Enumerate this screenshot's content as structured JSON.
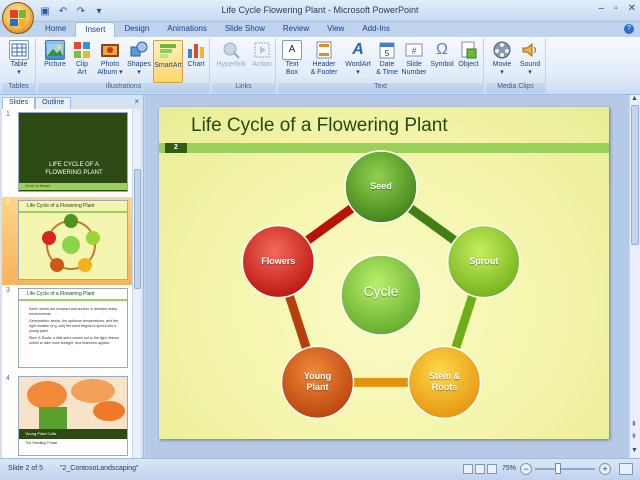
{
  "window": {
    "title": "Life Cycle Flowering Plant - Microsoft PowerPoint",
    "controls": {
      "minimize": "–",
      "maximize": "▫",
      "close": "✕"
    }
  },
  "qat": {
    "save_icon": "▣",
    "undo_icon": "↶",
    "redo_icon": "↷",
    "customize_icon": "▾"
  },
  "tabs": [
    {
      "label": "Home",
      "active": false
    },
    {
      "label": "Insert",
      "active": true
    },
    {
      "label": "Design",
      "active": false
    },
    {
      "label": "Animations",
      "active": false
    },
    {
      "label": "Slide Show",
      "active": false
    },
    {
      "label": "Review",
      "active": false
    },
    {
      "label": "View",
      "active": false
    },
    {
      "label": "Add-Ins",
      "active": false
    }
  ],
  "help": "?",
  "ribbon": {
    "groups": {
      "tables": "Tables",
      "illustrations": "Illustrations",
      "links": "Links",
      "text": "Text",
      "media": "Media Clips"
    },
    "buttons": {
      "table": "Table",
      "picture": "Picture",
      "clip_art": "Clip Art",
      "photo_album": "Photo Album",
      "shapes": "Shapes",
      "smartart": "SmartArt",
      "chart": "Chart",
      "hyperlink": "Hyperlink",
      "action": "Action",
      "text_box": "Text Box",
      "header_footer": "Header & Footer",
      "wordart": "WordArt",
      "date_time": "Date & Time",
      "slide_number": "Slide Number",
      "symbol": "Symbol",
      "object": "Object",
      "movie": "Movie",
      "sound": "Sound"
    },
    "button_lines": {
      "clip_art": [
        "Clip",
        "Art"
      ],
      "photo_album": [
        "Photo",
        "Album ▾"
      ],
      "text_box": [
        "Text",
        "Box"
      ],
      "header_footer": [
        "Header",
        "& Footer"
      ],
      "date_time": [
        "Date",
        "& Time"
      ],
      "slide_number": [
        "Slide",
        "Number"
      ]
    }
  },
  "pane": {
    "tabs": [
      "Slides",
      "Outline"
    ],
    "close": "×",
    "thumbs": [
      {
        "num": "1",
        "title_lines": [
          "LIFE CYCLE OF A",
          "FLOWERING PLANT"
        ],
        "subtitle": "Seed to flower"
      },
      {
        "num": "2",
        "title": "Life Cycle of a Flowering Plant"
      },
      {
        "num": "3",
        "title": "Life Cycle of a Flowering Plant",
        "bullets": [
          "Seed: seeds are compact and survive in dormant ready environments.",
          "Germination: seeds, the optimum temperatures, and the right location (e.g. soil) the seed begins to sprout into a young plant.",
          "Stem & Roots: a little stem comes out to the light, leaves unfold to take more sunlight, and branches appear."
        ]
      },
      {
        "num": "4",
        "caption": "Young Plant Cells",
        "caption_sub": "The Seedling Phase"
      }
    ]
  },
  "slide": {
    "title": "Life Cycle of a Flowering Plant",
    "number": "2",
    "center": "Cycle",
    "nodes": [
      {
        "label": "Seed",
        "color_light": "#8fd14f",
        "color_dark": "#3f7f16"
      },
      {
        "label": "Sprout",
        "color_light": "#c6ef5f",
        "color_dark": "#6fae18"
      },
      {
        "label": "Stem & Roots",
        "color_light": "#ffd94a",
        "color_dark": "#e3920c"
      },
      {
        "label": "Young Plant",
        "color_light": "#f08a3a",
        "color_dark": "#b6400b"
      },
      {
        "label": "Flowers",
        "color_light": "#f36a5a",
        "color_dark": "#b8120d"
      }
    ],
    "center_colors": {
      "light": "#b9f06a",
      "dark": "#5fa82a"
    }
  },
  "status": {
    "slide_of": "Slide 2 of 5",
    "theme": "\"2_ContosoLandscaping\"",
    "zoom": "75%",
    "zoom_minus": "−",
    "zoom_plus": "+"
  }
}
